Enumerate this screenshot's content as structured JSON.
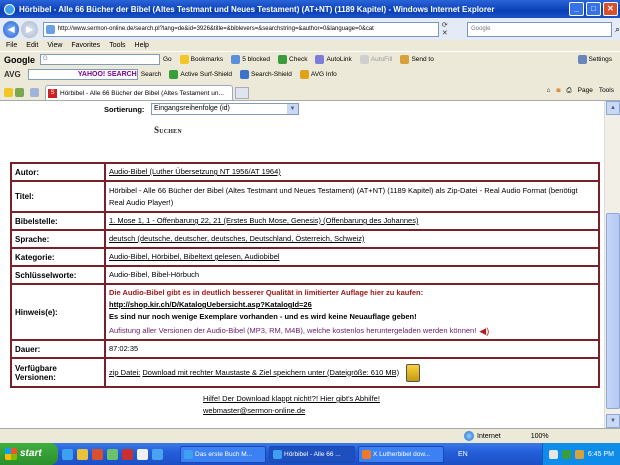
{
  "window": {
    "title": "Hörbibel - Alle 66 Bücher der Bibel (Altes Testmant und Neues Testament) (AT+NT) (1189 Kapitel) - Windows Internet Explorer"
  },
  "addressbar": {
    "url": "http://www.sermon-online.de/search.pl?lang=de&id=3926&title=&biblevers=&searchstring=&author=0&language=0&cat",
    "search_placeholder": "Google"
  },
  "menu": [
    "File",
    "Edit",
    "View",
    "Favorites",
    "Tools",
    "Help"
  ],
  "toolbar1": {
    "google_label": "Google",
    "google_input": "G",
    "go": "Go",
    "bookmarks": "Bookmarks",
    "blocked": "5 blocked",
    "check": "Check",
    "autolink": "AutoLink",
    "autofill": "AutoFill",
    "sendto": "Send to",
    "settings": "Settings"
  },
  "toolbar2": {
    "avg": "AVG",
    "yahoo": "YAHOO! SEARCH",
    "search": "Search",
    "active_shield": "Active Surf-Shield",
    "search_shield": "Search-Shield",
    "avg_info": "AVG Info"
  },
  "tabbar": {
    "tab_title": "Hörbibel - Alle 66 Bücher der Bibel (Altes Testament un...",
    "page": "Page",
    "tools": "Tools"
  },
  "sort": {
    "label": "Sortierung:",
    "value": "Eingangsreihenfolge (id)"
  },
  "search_button": "Suchen",
  "rows": [
    {
      "label": "Autor:",
      "value": "Audio-Bibel (Luther Übersetzung NT 1956/AT 1964)"
    },
    {
      "label": "Titel:",
      "value": "Hörbibel - Alle 66 Bücher der Bibel (Altes Testmant und Neues Testament) (AT+NT) (1189 Kapitel) als Zip-Datei - Real Audio Format (benötigt Real Audio Player!)"
    },
    {
      "label": "Bibelstelle:",
      "value": "1. Mose 1, 1 - Offenbarung 22, 21 (Erstes Buch Mose, Genesis) (Offenbarung des Johannes)"
    },
    {
      "label": "Sprache:",
      "value": "deutsch (deutsche, deutscher, deutsches, Deutschland, Österreich, Schweiz)"
    },
    {
      "label": "Kategorie:",
      "value": "Audio-Bibel, Hörbibel, Bibeltext gelesen, Audiobibel"
    },
    {
      "label": "Schlüsselworte:",
      "value": "Audio-Bibel, Bibel-Hörbuch"
    },
    {
      "label": "Hinweis(e):",
      "value_line1": "Die Audio-Bibel gibt es in deutlich besserer Qualität in limitierter Auflage hier zu kaufen:",
      "value_link": "http://shop.kir.ch/D/KatalogUebersicht.asp?KatalogId=26",
      "value_line3": "Es sind nur noch wenige Exemplare vorhanden - und es wird keine Neuauflage geben!",
      "value_line4": "Aufistung aller Versionen der Audio-Bibel (MP3, RM, M4B), welche kostenlos heruntergeladen werden können!"
    },
    {
      "label": "Dauer:",
      "value": "87:02:35"
    },
    {
      "label_line1": "Verfügbare",
      "label_line2": "Versionen:",
      "zip_label": "zip Datei:",
      "download": "Download mit rechter Maustaste & Ziel speichern unter (Dateigröße: 610 MB)"
    }
  ],
  "help_link": "Hilfe! Der Download klappt nicht!?! Hier gibt's Abhilfe!",
  "mail_link": "webmaster@sermon-online.de",
  "statusbar": {
    "zone": "Internet",
    "zoom": "100%"
  },
  "taskbar": {
    "start": "start",
    "tasks": [
      "Das erste Buch M...",
      "Hörbibel - Alle 66 ...",
      "X Lutherbibel dow..."
    ],
    "lang": "EN",
    "time": "6:45 PM"
  }
}
